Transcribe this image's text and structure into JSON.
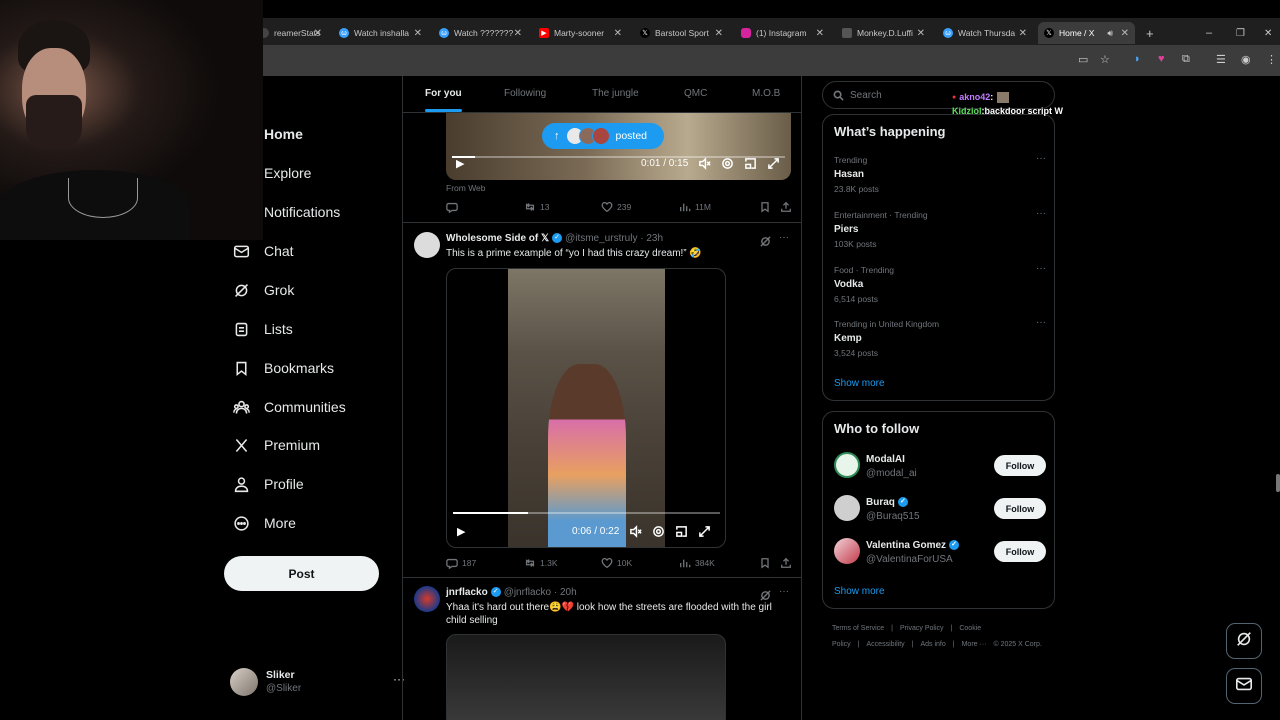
{
  "browser": {
    "tabs": [
      {
        "label": "reamerStats",
        "favicon": "generic-icon",
        "color": "#444"
      },
      {
        "label": "Watch inshalla",
        "favicon": "watch-icon",
        "color": "#3aa0ff"
      },
      {
        "label": "Watch ???????",
        "favicon": "watch-icon",
        "color": "#3aa0ff"
      },
      {
        "label": "Marty-sooner",
        "favicon": "youtube-icon",
        "color": "#ff0000"
      },
      {
        "label": "Barstool Sport",
        "favicon": "x-icon",
        "color": "#000"
      },
      {
        "label": "(1) Instagram",
        "favicon": "instagram-icon",
        "color": "#d6249f"
      },
      {
        "label": "Monkey.D.Luffi",
        "favicon": "doc-icon",
        "color": "#555"
      },
      {
        "label": "Watch Thursda",
        "favicon": "watch-icon",
        "color": "#3aa0ff"
      },
      {
        "label": "Home / X",
        "favicon": "x-icon",
        "color": "#000",
        "active": true
      }
    ],
    "new_tab": "+",
    "win_min": "–",
    "win_max": "❐",
    "win_close": "✕"
  },
  "sidebar": {
    "items": [
      {
        "label": "Home",
        "icon": "home-icon",
        "bold": true
      },
      {
        "label": "Explore",
        "icon": "search-icon"
      },
      {
        "label": "Notifications",
        "icon": "bell-icon"
      },
      {
        "label": "Chat",
        "icon": "mail-icon"
      },
      {
        "label": "Grok",
        "icon": "grok-icon"
      },
      {
        "label": "Lists",
        "icon": "list-icon"
      },
      {
        "label": "Bookmarks",
        "icon": "bookmark-icon"
      },
      {
        "label": "Communities",
        "icon": "communities-icon"
      },
      {
        "label": "Premium",
        "icon": "x-logo-icon"
      },
      {
        "label": "Profile",
        "icon": "person-icon"
      },
      {
        "label": "More",
        "icon": "more-circle-icon"
      }
    ],
    "post_label": "Post",
    "account": {
      "name": "Sliker",
      "handle": "@Sliker",
      "menu": "···"
    }
  },
  "feed": {
    "tabs": [
      "For you",
      "Following",
      "The jungle",
      "QMC",
      "M.O.B"
    ],
    "active_tab": "For you",
    "posted_pill": "posted",
    "tweet1": {
      "time": "0:01 / 0:15",
      "progress_fraction": 0.07,
      "source": "From Web",
      "reposts": "13",
      "likes": "239",
      "views": "11M"
    },
    "tweet2": {
      "name": "Wholesome Side of 𝕏",
      "handle": "@itsme_urstruly",
      "age": "· 23h",
      "text": "This is a prime example of “yo I had this crazy dream!” 🤣",
      "time": "0:06 / 0:22",
      "progress_fraction": 0.28,
      "replies": "187",
      "reposts": "1.3K",
      "likes": "10K",
      "views": "384K"
    },
    "tweet3": {
      "name": "jnrflacko",
      "handle": "@jnrflacko",
      "age": "· 20h",
      "text": "Yhaa it's hard out there😩💔 look how the streets are flooded with the girl child selling"
    }
  },
  "right": {
    "search_placeholder": "Search",
    "whats_happening": "What’s happening",
    "trends": [
      {
        "context": "Trending",
        "title": "Hasan",
        "posts": "23.8K posts"
      },
      {
        "context": "Entertainment · Trending",
        "title": "Piers",
        "posts": "103K posts"
      },
      {
        "context": "Food · Trending",
        "title": "Vodka",
        "posts": "6,514 posts"
      },
      {
        "context": "Trending in United Kingdom",
        "title": "Kemp",
        "posts": "3,524 posts"
      }
    ],
    "trend_menu": "···",
    "show_more": "Show more",
    "who_to_follow": "Who to follow",
    "follow": [
      {
        "name": "ModalAI",
        "handle": "@modal_ai",
        "verified": false,
        "button": "Follow"
      },
      {
        "name": "Buraq",
        "handle": "@Buraq515",
        "verified": true,
        "button": "Follow"
      },
      {
        "name": "Valentina Gomez",
        "handle": "@ValentinaForUSA",
        "verified": true,
        "button": "Follow"
      }
    ],
    "footer": [
      "Terms of Service",
      "|",
      "Privacy Policy",
      "|",
      "Cookie Policy",
      "|",
      "Accessibility",
      "|",
      "Ads info",
      "|",
      "More ···",
      "© 2025 X Corp."
    ]
  },
  "chat_overlay": [
    {
      "user": "akno42",
      "sep": " :",
      "message": ""
    },
    {
      "user": "Kidziol",
      "sep": " :",
      "message": " backdoor script W"
    }
  ],
  "colors": {
    "accent": "#1d9bf0",
    "bg": "#000000",
    "border": "#2f3336",
    "muted": "#71767b"
  }
}
